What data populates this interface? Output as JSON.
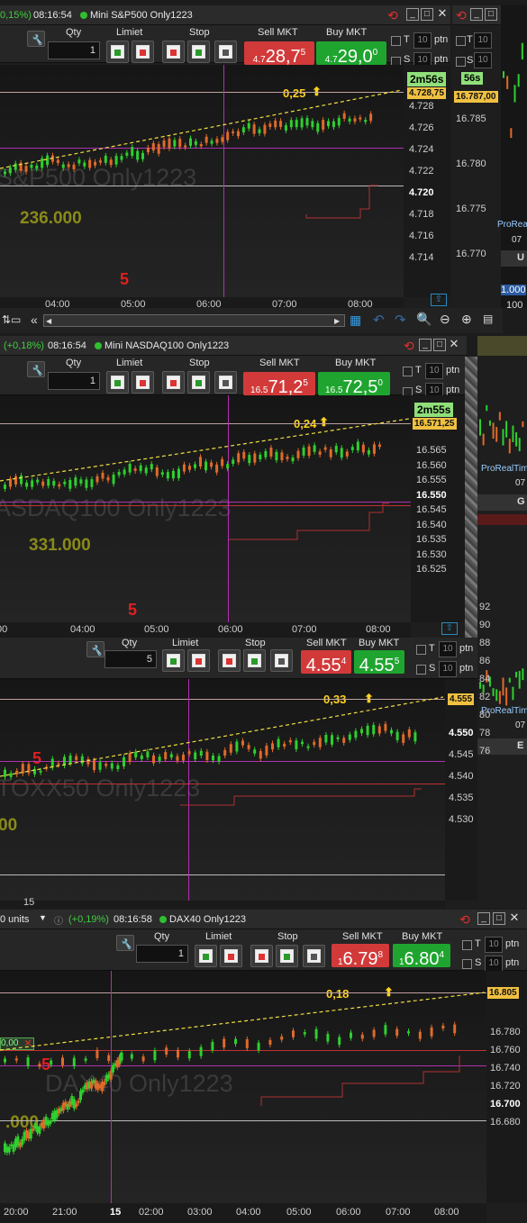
{
  "windows": [
    {
      "change": "0,15%)",
      "time": "08:16:54",
      "name": "Mini S&P500 Only1223",
      "qty": "1",
      "sell_label": "Sell MKT",
      "buy_label": "Buy MKT",
      "qty_label": "Qty",
      "limit_label": "Limiet",
      "stop_label": "Stop",
      "sell_pre": "4.7",
      "sell_main": "28,7",
      "sell_sup": "5",
      "buy_pre": "4.7",
      "buy_main": "29,0",
      "buy_sup": "0",
      "t": "T",
      "s": "S",
      "ptn": "ptn",
      "small_qty": "10",
      "countdown": "2m56s",
      "price_tag": "4.728,75",
      "pct": "0,25",
      "watermark": "S&P500 Only1223",
      "volume": "236.000",
      "period": "5",
      "yticks": [
        "4.728",
        "4.726",
        "4.724",
        "4.722",
        "4.720",
        "4.718",
        "4.716",
        "4.714"
      ],
      "xticks": [
        "04:00",
        "05:00",
        "06:00",
        "07:00",
        "08:00"
      ]
    },
    {
      "change": "(+0,18%)",
      "time": "08:16:54",
      "name": "Mini NASDAQ100 Only1223",
      "qty": "1",
      "sell_label": "Sell MKT",
      "buy_label": "Buy MKT",
      "qty_label": "Qty",
      "limit_label": "Limiet",
      "stop_label": "Stop",
      "sell_pre": "16.5",
      "sell_main": "71,2",
      "sell_sup": "5",
      "buy_pre": "16.5",
      "buy_main": "72,5",
      "buy_sup": "0",
      "t": "T",
      "s": "S",
      "ptn": "ptn",
      "small_qty": "10",
      "countdown": "2m55s",
      "price_tag": "16.571,25",
      "pct": "0,24",
      "watermark": "ASDAQ100 Only1223",
      "volume": "331.000",
      "period": "5",
      "yticks": [
        "16.565",
        "16.560",
        "16.555",
        "16.550",
        "16.545",
        "16.540",
        "16.535",
        "16.530",
        "16.525"
      ],
      "xticks": [
        "00",
        "04:00",
        "05:00",
        "06:00",
        "07:00",
        "08:00"
      ]
    },
    {
      "qty": "5",
      "sell_label": "Sell MKT",
      "buy_label": "Buy MKT",
      "qty_label": "Qty",
      "limit_label": "Limiet",
      "stop_label": "Stop",
      "sell_main": "4.55",
      "sell_sup": "4",
      "buy_main": "4.55",
      "buy_sup": "5",
      "t": "T",
      "s": "S",
      "ptn": "ptn",
      "small_qty": "10",
      "price_tag": "4.555",
      "pct": "0,33",
      "watermark": "TOXX50 Only1223",
      "volume": "00",
      "period": "5",
      "yticks": [
        "4.550",
        "4.545",
        "4.540",
        "4.535",
        "4.530"
      ],
      "xticks": [
        "15"
      ]
    },
    {
      "units": "0 units",
      "change": "(+0,19%)",
      "time": "08:16:58",
      "name": "DAX40 Only1223",
      "qty": "1",
      "sell_label": "Sell MKT",
      "buy_label": "Buy MKT",
      "qty_label": "Qty",
      "limit_label": "Limiet",
      "stop_label": "Stop",
      "sell_pre": "1",
      "sell_main": "6.79",
      "sell_sup": "8",
      "buy_pre": "1",
      "buy_main": "6.80",
      "buy_sup": "4",
      "t": "T",
      "s": "S",
      "ptn": "ptn",
      "small_qty": "10",
      "price_tag": "16.805",
      "pct": "0,18",
      "watermark": "DAX40 Only1223",
      "volume": ".000",
      "period": "5",
      "order_tag": "0,00",
      "close_x": "✕",
      "yticks": [
        "16.780",
        "16.760",
        "16.740",
        "16.720",
        "16.700",
        "16.680"
      ],
      "xticks": [
        "20:00",
        "21:00",
        "15",
        "02:00",
        "03:00",
        "04:00",
        "05:00",
        "06:00",
        "07:00",
        "08:00"
      ]
    }
  ],
  "side": {
    "yticks": [
      "16.785",
      "16.780",
      "16.775",
      "16.770"
    ],
    "price_tag": "16.787,00",
    "countdown": "56s",
    "t": "T",
    "s": "S",
    "ptn": "ptn",
    "small_qty": "10",
    "proreal1": "ProRealTim",
    "val1": "07",
    "u": "U",
    "val2": "1.000",
    "val3": "100",
    "proreal2": "ProRealTim",
    "val4": "07",
    "g": "G",
    "proreal3": "ProRealTim",
    "val5": "07",
    "e": "E",
    "eticks": [
      "92",
      "90",
      "88",
      "86",
      "84",
      "82",
      "80",
      "78",
      "76"
    ]
  },
  "scrollbar": {
    "arrow": "«"
  }
}
